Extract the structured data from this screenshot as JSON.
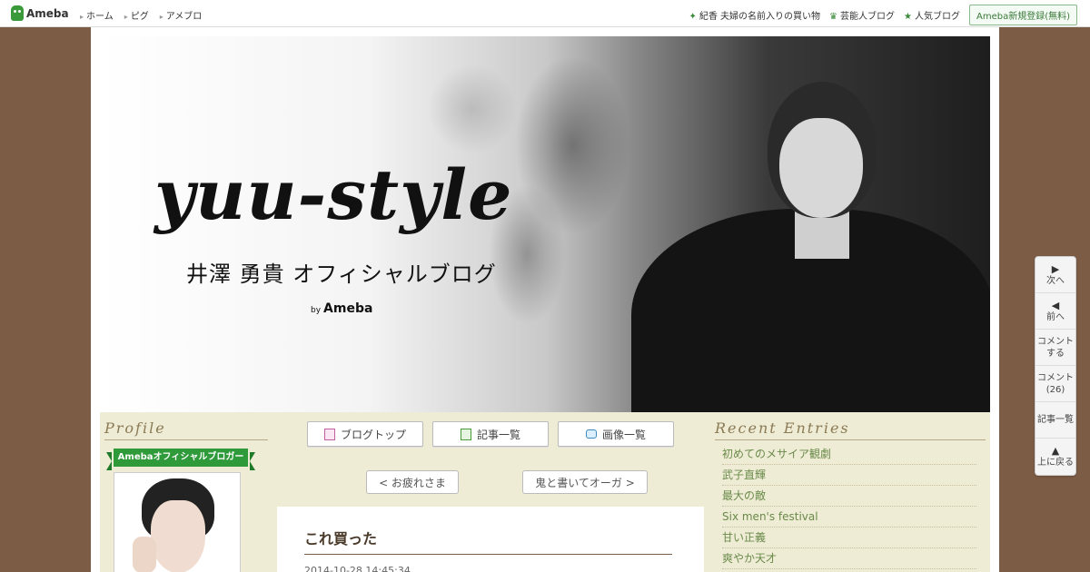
{
  "topbar": {
    "logo": "Ameba",
    "nav": [
      "ホーム",
      "ピグ",
      "アメブロ"
    ],
    "links": [
      {
        "icon": "sparkle-icon",
        "label": "紀香 夫婦の名前入りの買い物"
      },
      {
        "icon": "crown-icon",
        "label": "芸能人ブログ"
      },
      {
        "icon": "star-icon",
        "label": "人気ブログ"
      }
    ],
    "register": "Ameba新規登録(無料)"
  },
  "header": {
    "title": "yuu-style",
    "subtitle": "井澤 勇貴 オフィシャルブログ",
    "by": "by",
    "brand": "Ameba"
  },
  "profile": {
    "heading": "Profile",
    "ribbon": "Amebaオフィシャルブロガー"
  },
  "nav_buttons": [
    {
      "icon": "blog-icon",
      "label": "ブログトップ"
    },
    {
      "icon": "list-icon",
      "label": "記事一覧"
    },
    {
      "icon": "camera-icon",
      "label": "画像一覧"
    }
  ],
  "pager": {
    "prev": "< お疲れさま",
    "next": "鬼と書いてオーガ >"
  },
  "entry": {
    "title": "これ買った",
    "date": "2014-10-28 14:45:34"
  },
  "recent": {
    "heading": "Recent Entries",
    "items": [
      "初めてのメサイア観劇",
      "武子直輝",
      "最大の敵",
      "Six men's festival",
      "甘い正義",
      "爽やか天才"
    ]
  },
  "side_nav": [
    {
      "icon": "right-arrow-icon",
      "label": "次へ"
    },
    {
      "icon": "left-arrow-icon",
      "label": "前へ"
    },
    {
      "icon": "",
      "label": "コメント する"
    },
    {
      "icon": "",
      "label": "コメント (26)"
    },
    {
      "icon": "",
      "label": "記事一覧"
    },
    {
      "icon": "up-arrow-icon",
      "label": "上に戻る"
    }
  ],
  "colors": {
    "page_bg": "#7d5c45",
    "band_bg": "#efecd5",
    "accent_green": "#2f9a3a",
    "link_green": "#6a8a4a"
  }
}
